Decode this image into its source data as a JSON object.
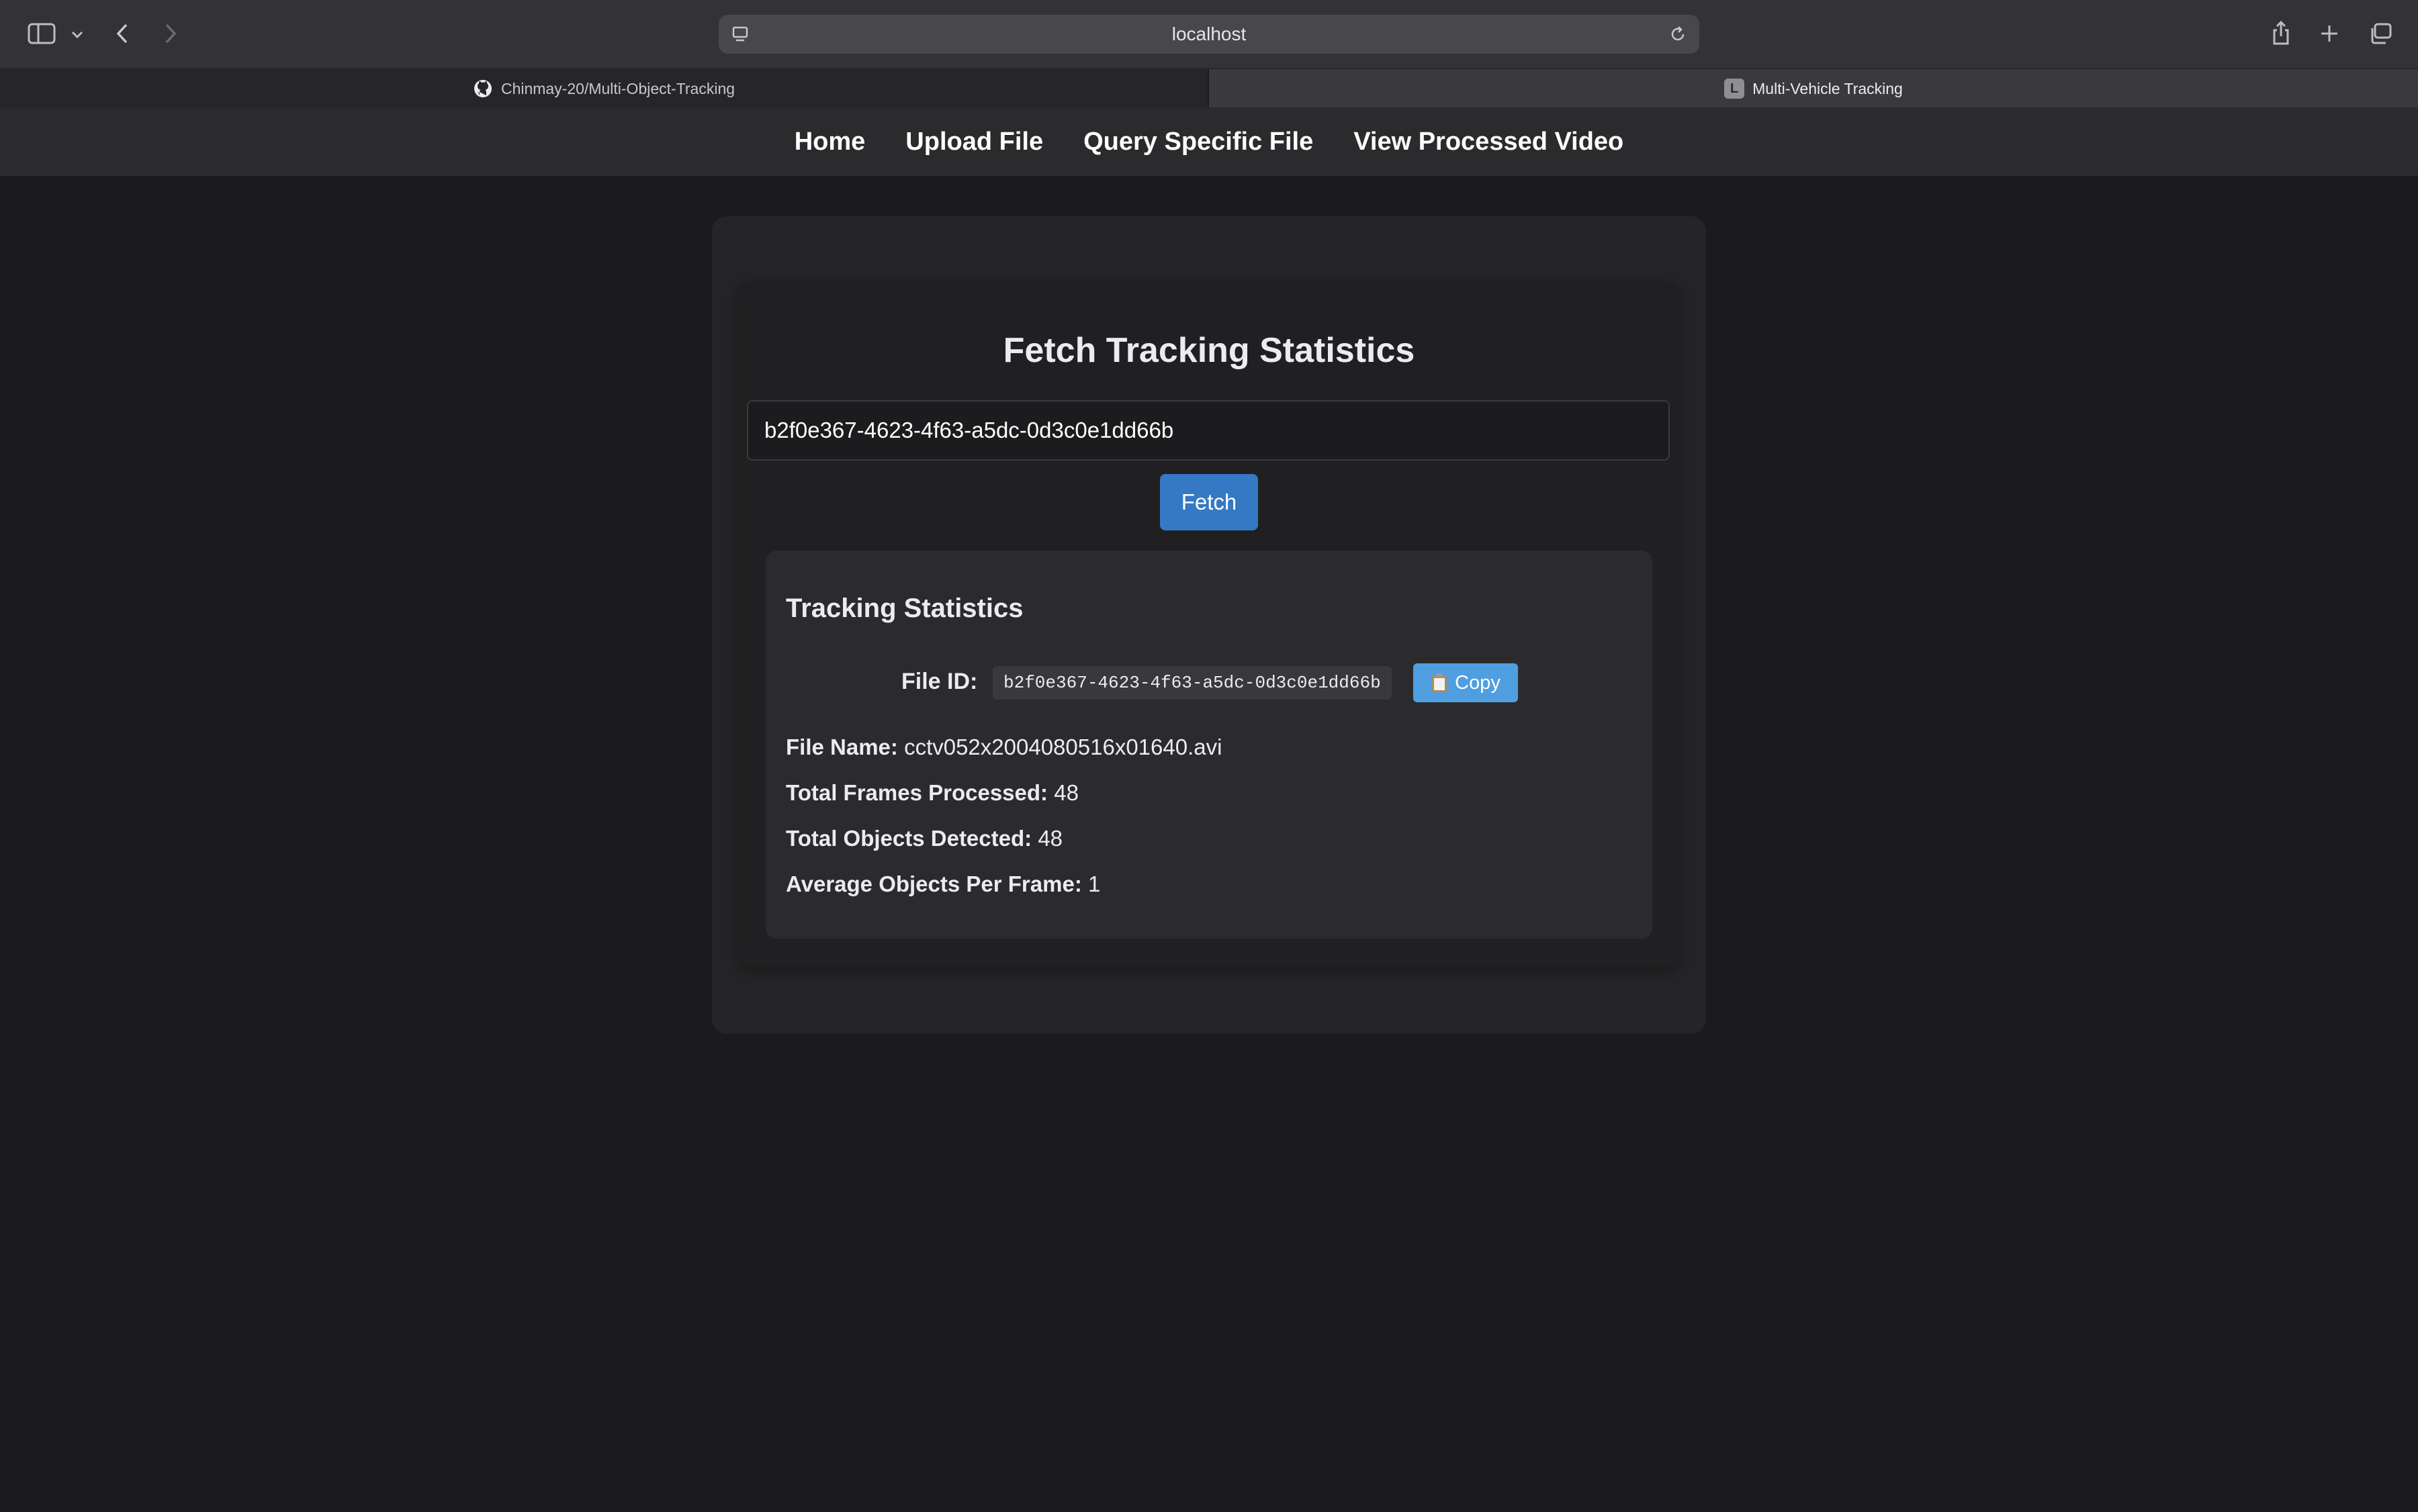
{
  "browser": {
    "address": "localhost",
    "tabs": [
      {
        "label": "Chinmay-20/Multi-Object-Tracking",
        "icon": "github-icon",
        "active": false
      },
      {
        "label": "Multi-Vehicle Tracking",
        "icon_letter": "L",
        "active": true
      }
    ]
  },
  "nav": {
    "items": [
      "Home",
      "Upload File",
      "Query Specific File",
      "View Processed Video"
    ]
  },
  "fetch_form": {
    "title": "Fetch Tracking Statistics",
    "input_value": "b2f0e367-4623-4f63-a5dc-0d3c0e1dd66b",
    "button_label": "Fetch"
  },
  "stats": {
    "title": "Tracking Statistics",
    "file_id_label": "File ID:",
    "file_id_value": "b2f0e367-4623-4f63-a5dc-0d3c0e1dd66b",
    "copy_label": "Copy",
    "file_name_label": "File Name:",
    "file_name_value": "cctv052x2004080516x01640.avi",
    "frames_label": "Total Frames Processed:",
    "frames_value": "48",
    "objects_label": "Total Objects Detected:",
    "objects_value": "48",
    "avg_label": "Average Objects Per Frame:",
    "avg_value": "1"
  },
  "colors": {
    "background": "#1b1b1d",
    "nav_bar": "#2b2b2d",
    "fetch_button": "#3579c4",
    "copy_button": "#4f9fe0"
  }
}
